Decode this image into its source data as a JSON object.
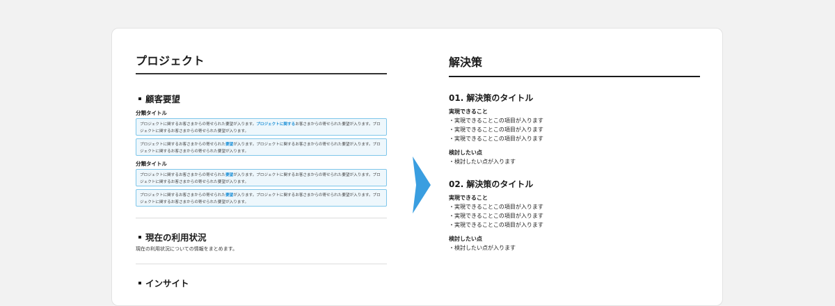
{
  "left": {
    "title": "プロジェクト",
    "sections": [
      {
        "title": "顧客要望"
      },
      {
        "title": "現在の利用状況",
        "description": "現在の利用状況についての情報をまとめます。"
      },
      {
        "title": "インサイト"
      }
    ],
    "categories": [
      {
        "label": "分類タイトル",
        "requests": [
          {
            "pre": "プロジェクトに関するお客さまからの寄せられた要望が入ります。",
            "hl": "プロジェクトに関する",
            "post": "お客さまからの寄せられた要望が入ります。プロジェクトに関するお客さまからの寄せられた要望が入ります。"
          },
          {
            "pre": "プロジェクトに関するお客さまからの寄せられた",
            "hl": "要望",
            "post": "が入ります。プロジェクトに関するお客さまからの寄せられた要望が入ります。プロジェクトに関するお客さまからの寄せられた要望が入ります。"
          }
        ]
      },
      {
        "label": "分類タイトル",
        "requests": [
          {
            "pre": "プロジェクトに関するお客さまからの寄せられた",
            "hl": "要望",
            "post": "が入ります。プロジェクトに関するお客さまからの寄せられた要望が入ります。プロジェクトに関するお客さまからの寄せられた要望が入ります。"
          },
          {
            "pre": "プロジェクトに関するお客さまからの寄せられた",
            "hl": "要望",
            "post": "が入ります。プロジェクトに関するお客さまからの寄せられた要望が入ります。プロジェクトに関するお客さまからの寄せられた要望が入ります。"
          }
        ]
      }
    ]
  },
  "right": {
    "title": "解決策",
    "solutions": [
      {
        "title": "01. 解決策のタイトル",
        "can_label": "実現できること",
        "can_items": [
          "・実現できることこの項目が入ります",
          "・実現できることこの項目が入ります",
          "・実現できることこの項目が入ります"
        ],
        "consider_label": "検討したい点",
        "consider_items": [
          "・検討したい点が入ります"
        ]
      },
      {
        "title": "02. 解決策のタイトル",
        "can_label": "実現できること",
        "can_items": [
          "・実現できることこの項目が入ります",
          "・実現できることこの項目が入ります",
          "・実現できることこの項目が入ります"
        ],
        "consider_label": "検討したい点",
        "consider_items": [
          "・検討したい点が入ります"
        ]
      }
    ]
  },
  "colors": {
    "arrow": "#3a9ee0",
    "highlight": "#1b8fd6",
    "box_border": "#7ec6ea",
    "box_bg": "#eef7fc"
  }
}
